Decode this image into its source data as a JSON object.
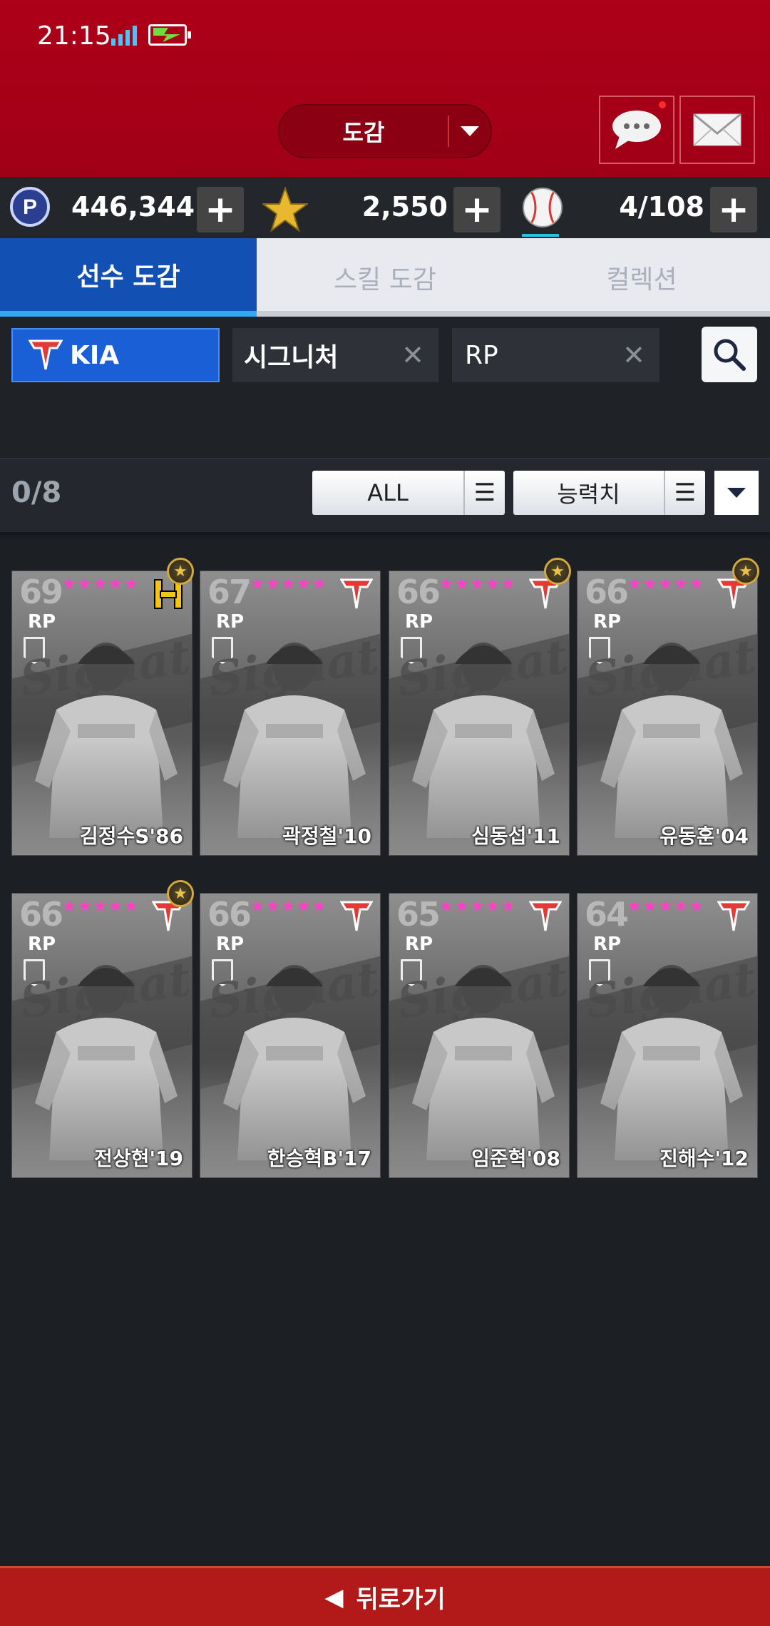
{
  "status": {
    "time": "21:15"
  },
  "header": {
    "title": "도감"
  },
  "resources": {
    "points": "446,344",
    "stars": "2,550",
    "balls": "4/108"
  },
  "tabs": [
    {
      "label": "선수 도감",
      "active": true
    },
    {
      "label": "스킬 도감",
      "active": false
    },
    {
      "label": "컬렉션",
      "active": false
    }
  ],
  "filters": {
    "team": "KIA",
    "type": "시그니처",
    "position": "RP"
  },
  "count": "0/8",
  "sort": {
    "filter_label": "ALL",
    "stat_label": "능력치"
  },
  "cards": [
    {
      "ovr": "69",
      "pos": "RP",
      "stars": "★★★★★",
      "name": "김정수S'86",
      "gold": true,
      "logo": "haitai"
    },
    {
      "ovr": "67",
      "pos": "RP",
      "stars": "★★★★★",
      "name": "곽정철'10",
      "gold": false,
      "logo": "tigers"
    },
    {
      "ovr": "66",
      "pos": "RP",
      "stars": "★★★★★",
      "name": "심동섭'11",
      "gold": true,
      "logo": "tigers"
    },
    {
      "ovr": "66",
      "pos": "RP",
      "stars": "★★★★★",
      "name": "유동훈'04",
      "gold": true,
      "logo": "tigers"
    },
    {
      "ovr": "66",
      "pos": "RP",
      "stars": "★★★★★",
      "name": "전상현'19",
      "gold": true,
      "logo": "tigers"
    },
    {
      "ovr": "66",
      "pos": "RP",
      "stars": "★★★★★",
      "name": "한승혁B'17",
      "gold": false,
      "logo": "tigers"
    },
    {
      "ovr": "65",
      "pos": "RP",
      "stars": "★★★★★",
      "name": "임준혁'08",
      "gold": false,
      "logo": "tigers"
    },
    {
      "ovr": "64",
      "pos": "RP",
      "stars": "★★★★★",
      "name": "진해수'12",
      "gold": false,
      "logo": "tigers"
    }
  ],
  "card_bg_text": "Signature",
  "footer": {
    "back_label": "뒤로가기"
  },
  "colors": {
    "header": "#ad0019",
    "tab_active": "#1350b4",
    "accent": "#33a7f0",
    "star": "#ff3fc8"
  }
}
